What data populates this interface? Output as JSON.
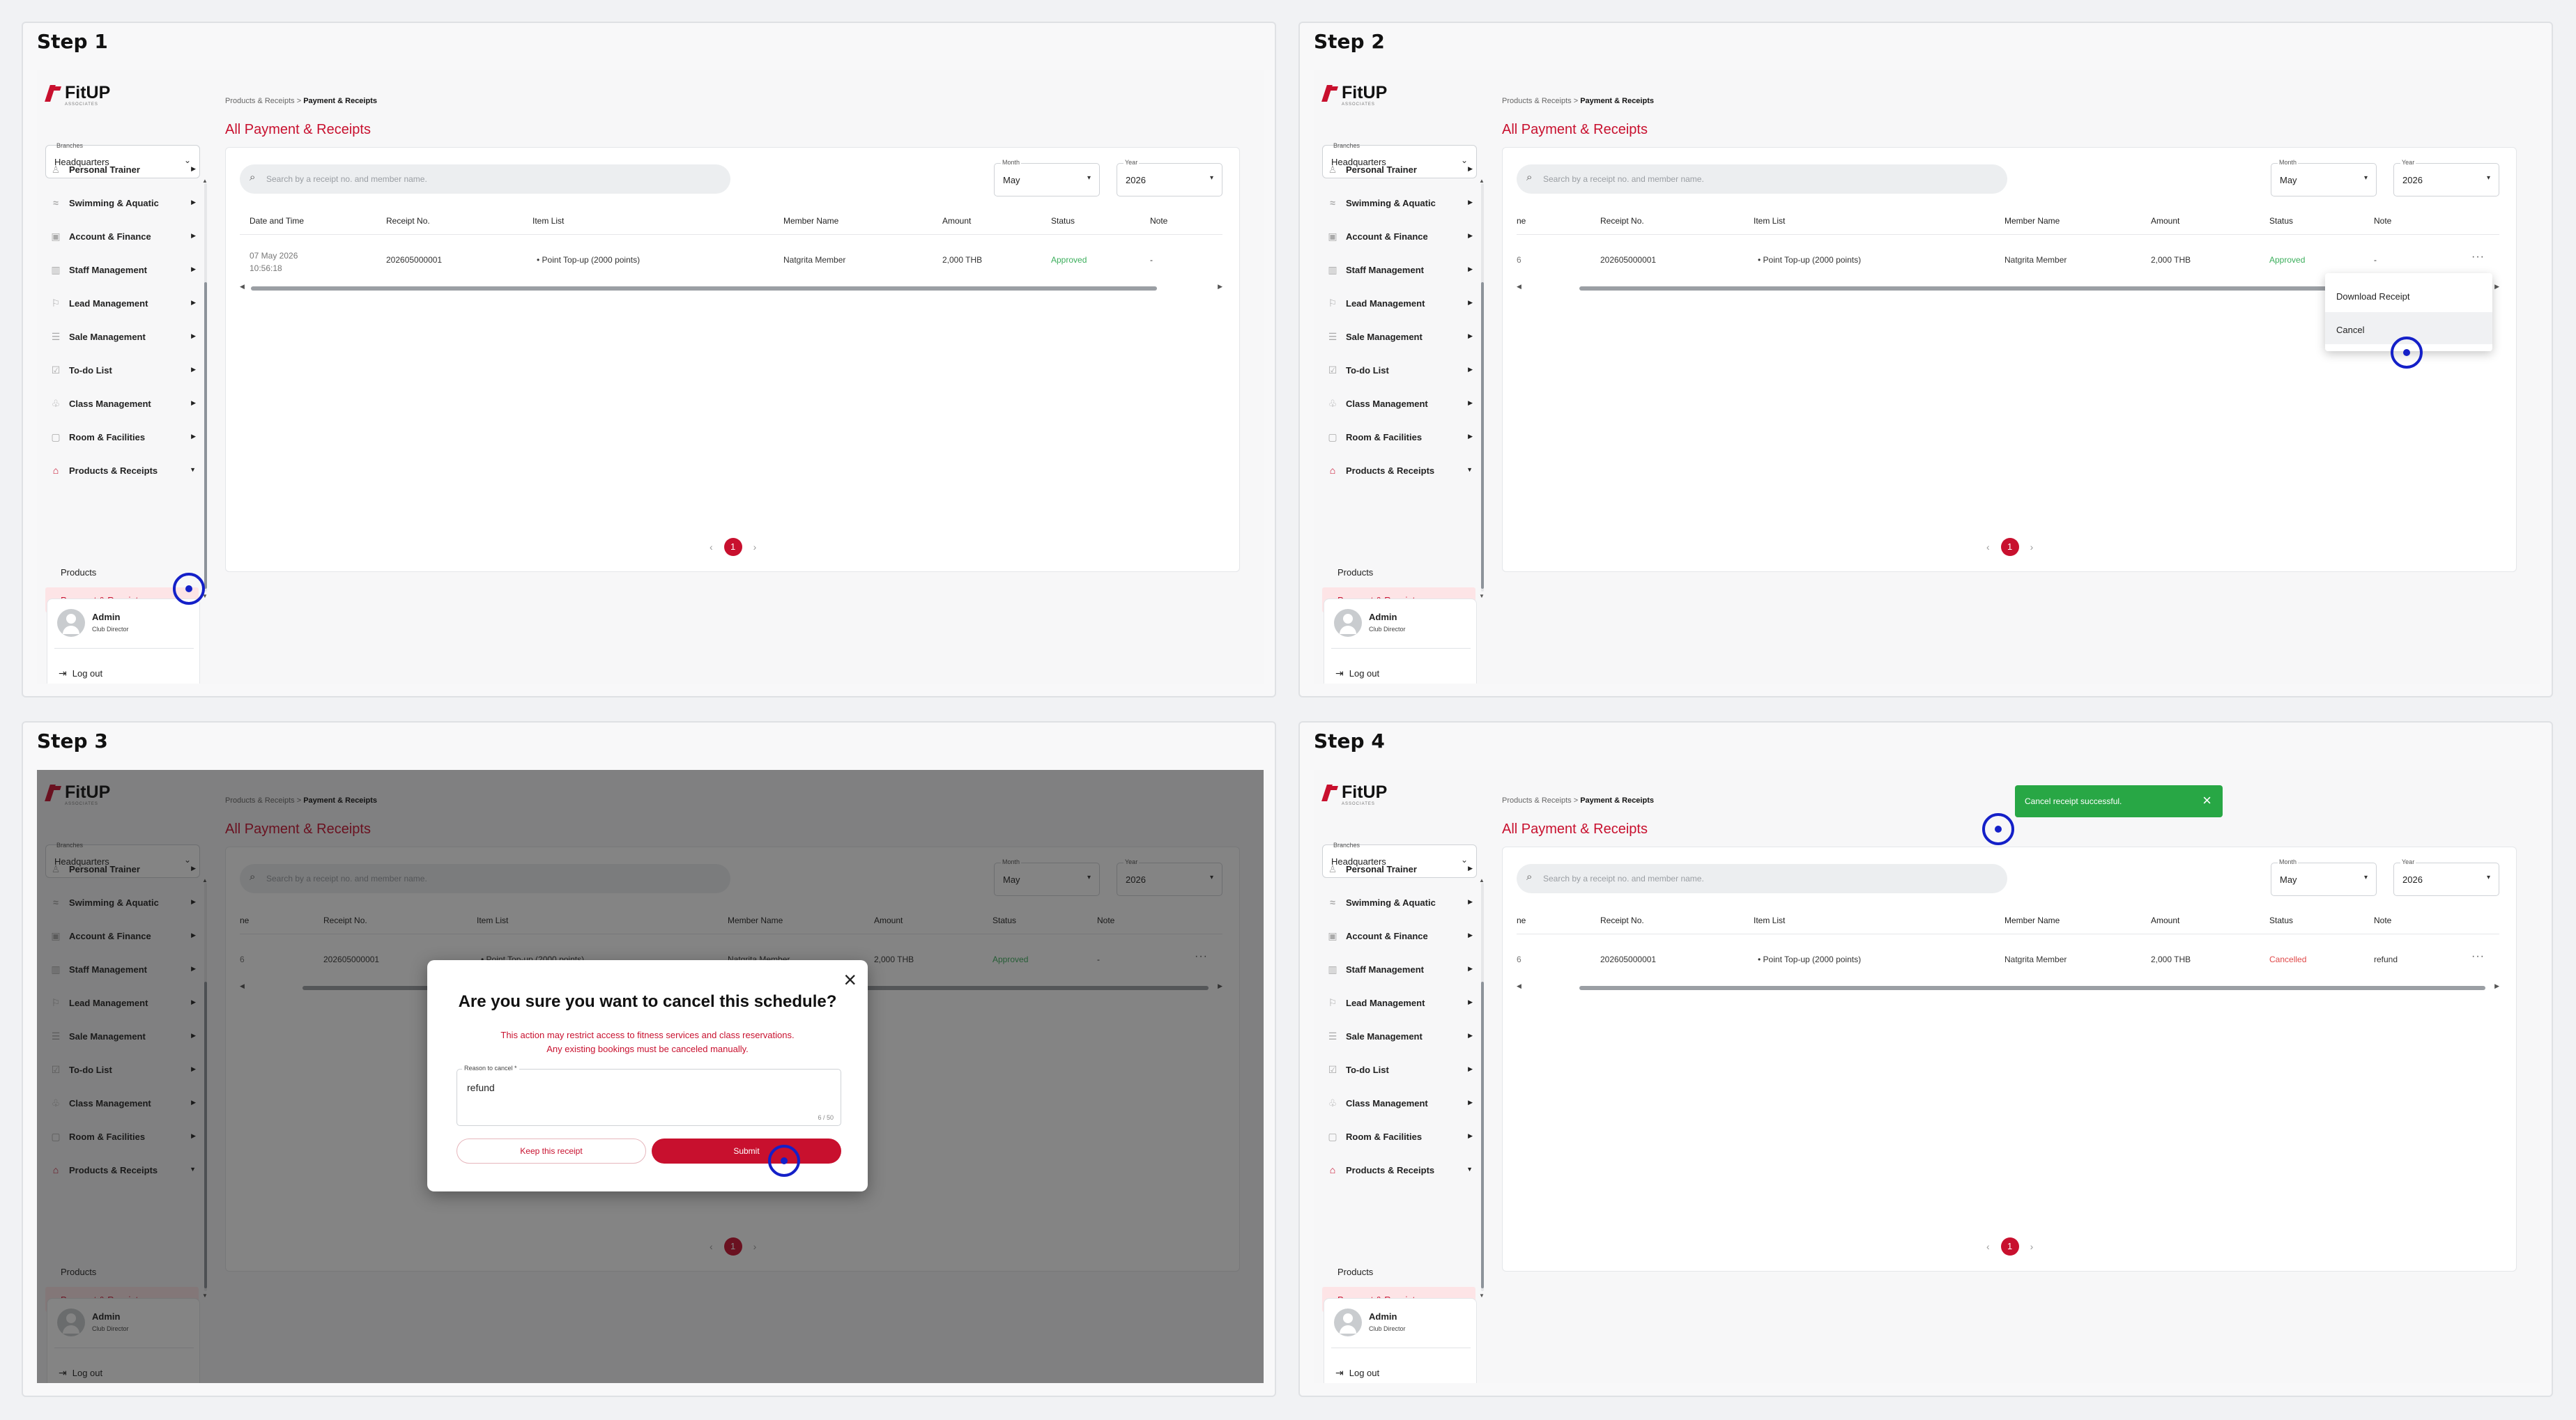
{
  "steps": [
    {
      "title": "Step 1"
    },
    {
      "title": "Step 2"
    },
    {
      "title": "Step 3"
    },
    {
      "title": "Step 4"
    }
  ],
  "brand": {
    "name": "FitUP",
    "sub": "ASSOCIATES",
    "accent": "#c8102e"
  },
  "branch": {
    "label": "Branches",
    "value": "Headquarters"
  },
  "nav": [
    {
      "label": "Personal Trainer",
      "icon": "trainer-icon"
    },
    {
      "label": "Swimming & Aquatic",
      "icon": "swim-icon"
    },
    {
      "label": "Account & Finance",
      "icon": "finance-icon"
    },
    {
      "label": "Staff Management",
      "icon": "staff-icon"
    },
    {
      "label": "Lead Management",
      "icon": "lead-icon"
    },
    {
      "label": "Sale Management",
      "icon": "sale-icon"
    },
    {
      "label": "To-do List",
      "icon": "todo-icon"
    },
    {
      "label": "Class Management",
      "icon": "class-icon"
    },
    {
      "label": "Room & Facilities",
      "icon": "room-icon"
    },
    {
      "label": "Products & Receipts",
      "icon": "products-icon"
    }
  ],
  "subnav": [
    {
      "label": "Products"
    },
    {
      "label": "Payment & Receipts"
    }
  ],
  "user": {
    "name": "Admin",
    "role": "Club Director",
    "logout": "Log out"
  },
  "breadcrumb": {
    "parent": "Products & Receipts",
    "sep": ">",
    "current": "Payment & Receipts"
  },
  "page_title": "All Payment & Receipts",
  "search": {
    "placeholder": "Search by a receipt no. and member name."
  },
  "filters": {
    "month_label": "Month",
    "month": "May",
    "year_label": "Year",
    "year": "2026"
  },
  "table": {
    "headers_full": [
      "Date and Time",
      "Receipt No.",
      "Item List",
      "Member Name",
      "Amount",
      "Status",
      "Note"
    ],
    "headers_scrolled": [
      "ne",
      "Receipt No.",
      "Item List",
      "Member Name",
      "Amount",
      "Status",
      "Note"
    ],
    "row": {
      "date": "07 May 2026",
      "time": "10:56:18",
      "date_clipped": "6",
      "receipt_no": "202605000001",
      "item": "Point Top-up (2000 points)",
      "member": "Natgrita Member",
      "amount": "2,000 THB",
      "status_approved": "Approved",
      "status_cancelled": "Cancelled",
      "note_empty": "-",
      "note_refund": "refund",
      "kebab": "···"
    }
  },
  "pager": {
    "prev": "‹",
    "page": "1",
    "next": "›"
  },
  "menu": {
    "download": "Download Receipt",
    "cancel": "Cancel"
  },
  "modal": {
    "title": "Are you sure you want to cancel this schedule?",
    "msg1": "This action may restrict access to fitness services and class reservations.",
    "msg2": "Any existing bookings must be canceled manually.",
    "reason_label": "Reason to cancel *",
    "reason_value": "refund",
    "reason_count": "6 / 50",
    "keep": "Keep this receipt",
    "submit": "Submit"
  },
  "toast": {
    "message": "Cancel receipt successful.",
    "close": "×"
  }
}
